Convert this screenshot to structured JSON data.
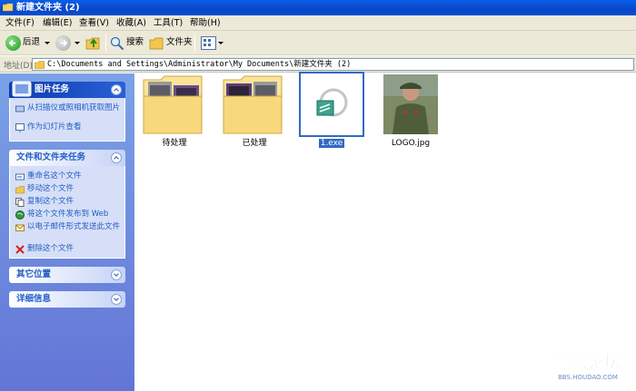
{
  "window": {
    "title": "新建文件夹 (2)"
  },
  "menu": [
    "文件(F)",
    "编辑(E)",
    "查看(V)",
    "收藏(A)",
    "工具(T)",
    "帮助(H)"
  ],
  "toolbar": {
    "back": "后退",
    "search": "搜索",
    "folders": "文件夹"
  },
  "address": {
    "label": "地址(D)",
    "path": "C:\\Documents and Settings\\Administrator\\My Documents\\新建文件夹 (2)"
  },
  "taskpane": {
    "picture_tasks": {
      "title": "图片任务",
      "items": [
        "从扫描仪或照相机获取图片",
        "作为幻灯片查看"
      ]
    },
    "file_tasks": {
      "title": "文件和文件夹任务",
      "items": [
        "重命名这个文件",
        "移动这个文件",
        "复制这个文件",
        "将这个文件发布到 Web",
        "以电子邮件形式发送此文件",
        "删除这个文件"
      ]
    },
    "other_places": {
      "title": "其它位置"
    },
    "details": {
      "title": "详细信息"
    }
  },
  "files": [
    {
      "name": "待处理",
      "type": "folder"
    },
    {
      "name": "已处理",
      "type": "folder"
    },
    {
      "name": "1.exe",
      "type": "exe",
      "selected": true
    },
    {
      "name": "LOGO.jpg",
      "type": "image"
    }
  ],
  "watermark": {
    "text": "猴岛论坛",
    "url": "BBS.HOUDAO.COM"
  },
  "colors": {
    "titlebar": "#0a5fe6",
    "taskpane": "#7ba2e7",
    "selection": "#316ac5"
  }
}
